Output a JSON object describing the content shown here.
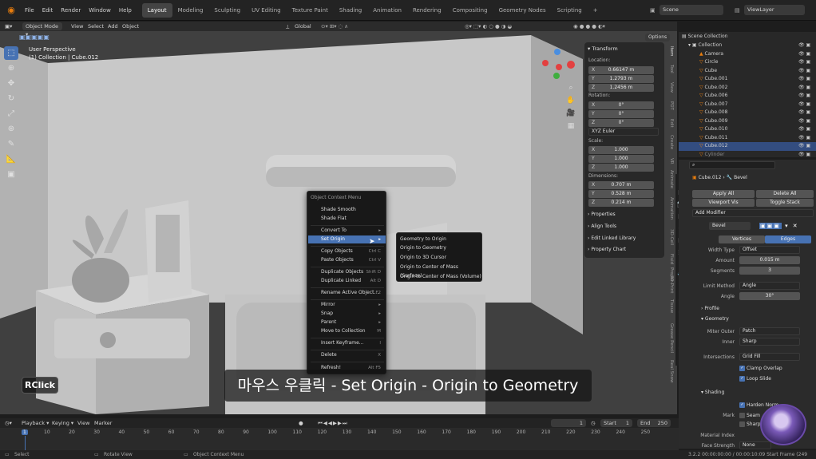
{
  "topbar": {
    "menus": [
      "File",
      "Edit",
      "Render",
      "Window",
      "Help"
    ],
    "workspaces": [
      "Layout",
      "Modeling",
      "Sculpting",
      "UV Editing",
      "Texture Paint",
      "Shading",
      "Animation",
      "Rendering",
      "Compositing",
      "Geometry Nodes",
      "Scripting"
    ],
    "active_workspace": "Layout",
    "add_tab": "+",
    "scene_label": "Scene",
    "viewlayer_label": "ViewLayer"
  },
  "viewport_header": {
    "mode": "Object Mode",
    "menus": [
      "View",
      "Select",
      "Add",
      "Object"
    ],
    "orientation": "Global",
    "options": "Options"
  },
  "viewport": {
    "perspective": "User Perspective",
    "collection_path": "(1) Collection | Cube.012"
  },
  "context_menu": {
    "title": "Object Context Menu",
    "items": [
      {
        "label": "Shade Smooth",
        "shortcut": ""
      },
      {
        "label": "Shade Flat",
        "shortcut": ""
      },
      {
        "label": "Convert To",
        "shortcut": "▸"
      },
      {
        "label": "Set Origin",
        "shortcut": "▸"
      },
      {
        "label": "Copy Objects",
        "shortcut": "Ctrl C"
      },
      {
        "label": "Paste Objects",
        "shortcut": "Ctrl V"
      },
      {
        "label": "Duplicate Objects",
        "shortcut": "Shift D"
      },
      {
        "label": "Duplicate Linked",
        "shortcut": "Alt D"
      },
      {
        "label": "Rename Active Object...",
        "shortcut": "F2"
      },
      {
        "label": "Mirror",
        "shortcut": "▸"
      },
      {
        "label": "Snap",
        "shortcut": "▸"
      },
      {
        "label": "Parent",
        "shortcut": "▸"
      },
      {
        "label": "Move to Collection",
        "shortcut": "M"
      },
      {
        "label": "Insert Keyframe...",
        "shortcut": "I"
      },
      {
        "label": "Delete",
        "shortcut": "X"
      },
      {
        "label": "Refresh!",
        "shortcut": "Alt F5"
      }
    ]
  },
  "set_origin_submenu": {
    "items": [
      "Geometry to Origin",
      "Origin to Geometry",
      "Origin to 3D Cursor",
      "Origin to Center of Mass (Surface)",
      "Origin to Center of Mass (Volume)"
    ]
  },
  "npanel": {
    "transform_title": "Transform",
    "location_label": "Location:",
    "location": {
      "x": "0.66147 m",
      "y": "1.2793 m",
      "z": "1.2456 m"
    },
    "rotation_label": "Rotation:",
    "rotation": {
      "x": "0°",
      "y": "0°",
      "z": "0°"
    },
    "rotation_mode": "XYZ Euler",
    "scale_label": "Scale:",
    "scale": {
      "x": "1.000",
      "y": "1.000",
      "z": "1.000"
    },
    "dimensions_label": "Dimensions:",
    "dimensions": {
      "x": "0.707 m",
      "y": "0.528 m",
      "z": "0.214 m"
    },
    "axes": [
      "X",
      "Y",
      "Z"
    ],
    "sections": [
      "Properties",
      "Align Tools",
      "Edit Linked Library",
      "Property Chart"
    ]
  },
  "npanel_tabs": [
    "Item",
    "Tool",
    "View",
    "PDT",
    "Edit",
    "Create",
    "VR",
    "Animate",
    "Animation",
    "3D-Cell",
    "Fluid",
    "Proper",
    "3D-Print",
    "Tissue",
    "Grease Pencil",
    "Real Snow"
  ],
  "outliner": {
    "header": "Scene Collection",
    "rows": [
      "Collection",
      "Camera",
      "Circle",
      "Cube",
      "Cube.001",
      "Cube.002",
      "Cube.006",
      "Cube.007",
      "Cube.008",
      "Cube.009",
      "Cube.010",
      "Cube.011",
      "Cube.012",
      "Cylinder"
    ],
    "selected": "Cube.012"
  },
  "properties": {
    "object_name": "Cube.012",
    "modifier_name": "Bevel",
    "apply_all": "Apply All",
    "delete_all": "Delete All",
    "viewport_vis": "Viewport Vis",
    "toggle_stack": "Toggle Stack",
    "add_modifier": "Add Modifier",
    "tabs": [
      "Vertices",
      "Edges"
    ],
    "active_tab": "Edges",
    "fields": [
      {
        "label": "Width Type",
        "value": "Offset",
        "kind": "dropdown"
      },
      {
        "label": "Amount",
        "value": "0.015 m",
        "kind": "number"
      },
      {
        "label": "Segments",
        "value": "3",
        "kind": "number"
      },
      {
        "label": "Limit Method",
        "value": "Angle",
        "kind": "dropdown"
      },
      {
        "label": "Angle",
        "value": "30°",
        "kind": "number"
      }
    ],
    "profile": "Profile",
    "geometry": "Geometry",
    "miter_outer_label": "Miter Outer",
    "miter_outer": "Patch",
    "inner_label": "Inner",
    "inner": "Sharp",
    "intersections_label": "Intersections",
    "intersections": "Grid Fill",
    "clamp_overlap": "Clamp Overlap",
    "loop_slide": "Loop Slide",
    "shading": "Shading",
    "harden_normals": "Harden Norm",
    "mark_label": "Mark",
    "seam": "Seam",
    "sharp": "Sharp",
    "material_index": "Material Index",
    "face_strength": "Face Strength",
    "face_strength_value": "None"
  },
  "timeline": {
    "menus": [
      "Playback",
      "Keying",
      "View",
      "Marker"
    ],
    "current_frame": "1",
    "start_label": "Start",
    "start": "1",
    "end_label": "End",
    "end": "250",
    "ticks": [
      "1",
      "10",
      "20",
      "30",
      "40",
      "50",
      "60",
      "70",
      "80",
      "90",
      "100",
      "110",
      "120",
      "130",
      "140",
      "150",
      "160",
      "170",
      "180",
      "190",
      "200",
      "210",
      "220",
      "230",
      "240",
      "250"
    ]
  },
  "statusbar": {
    "select": "Select",
    "rotate_view": "Rotate View",
    "context_menu": "Object Context Menu",
    "version_info": "3.2.2  00:00:00:00 / 00:00:10:09  Start Frame (249 left)"
  },
  "overlay": {
    "key_badge": "RClick",
    "subtitle": "마우스 우클릭 - Set Origin - Origin to Geometry"
  },
  "colors": {
    "accent": "#4772b3",
    "selected_row": "#334d80",
    "orange": "#e87d0d"
  }
}
